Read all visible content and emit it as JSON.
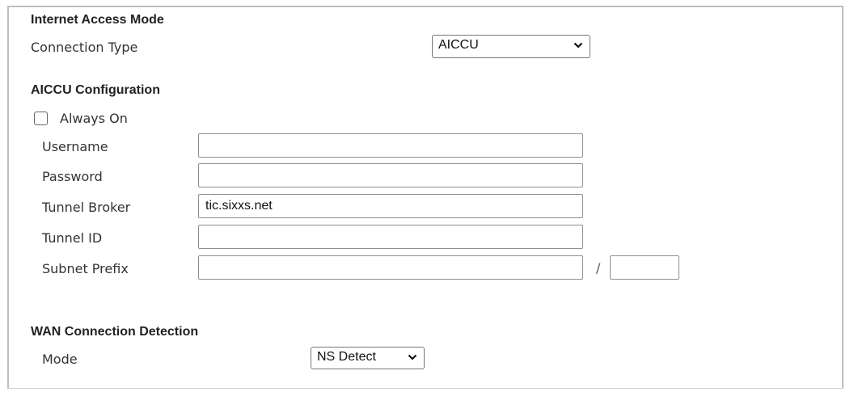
{
  "internet_access": {
    "heading": "Internet Access Mode",
    "connection_type_label": "Connection Type",
    "connection_type_value": "AICCU"
  },
  "aiccu": {
    "heading": "AICCU Configuration",
    "always_on_label": "Always On",
    "always_on_checked": false,
    "username_label": "Username",
    "username_value": "",
    "password_label": "Password",
    "password_value": "",
    "tunnel_broker_label": "Tunnel Broker",
    "tunnel_broker_value": "tic.sixxs.net",
    "tunnel_id_label": "Tunnel ID",
    "tunnel_id_value": "",
    "subnet_prefix_label": "Subnet Prefix",
    "subnet_prefix_value": "",
    "prefix_separator": "/",
    "prefix_length_value": ""
  },
  "wan_detection": {
    "heading": "WAN Connection Detection",
    "mode_label": "Mode",
    "mode_value": "NS Detect"
  },
  "icons": {
    "dropdown": "chevron-down-icon",
    "checkbox": "checkbox-unchecked"
  }
}
